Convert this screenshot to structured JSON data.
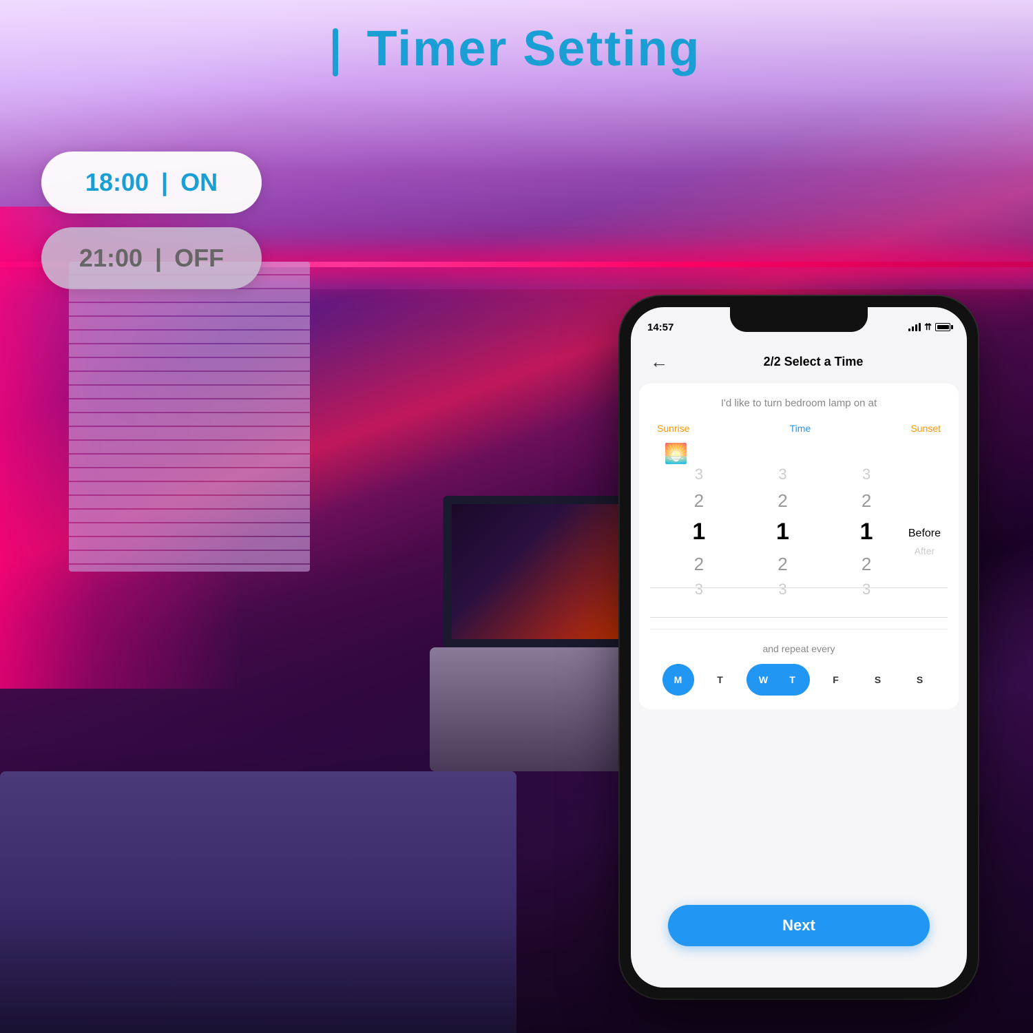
{
  "page": {
    "title": "Timer Setting",
    "background_color": "#1a0a2e"
  },
  "header": {
    "title_bar": "|",
    "title": "Timer Setting"
  },
  "timer_badges": [
    {
      "time": "18:00",
      "separator": "|",
      "action": "ON",
      "type": "on"
    },
    {
      "time": "21:00",
      "separator": "|",
      "action": "OFF",
      "type": "off"
    }
  ],
  "phone": {
    "status_bar": {
      "time": "14:57",
      "signal_label": "signal",
      "wifi_label": "wifi",
      "battery_label": "battery"
    },
    "screen_title": "2/2 Select a Time",
    "back_button": "←",
    "description": "I'd like to turn bedroom lamp on at",
    "time_picker": {
      "sunrise_label": "Sunrise",
      "time_label": "Time",
      "sunset_label": "Sunset",
      "columns": [
        {
          "id": "col1",
          "values": [
            "3",
            "2",
            "1",
            "2",
            "3"
          ]
        },
        {
          "id": "col2",
          "values": [
            "3",
            "2",
            "1",
            "2",
            "3"
          ]
        },
        {
          "id": "col3",
          "values": [
            "3",
            "2",
            "1",
            "2",
            "3"
          ]
        }
      ],
      "before_after": {
        "before": "Before",
        "after": "After"
      }
    },
    "repeat_label": "and repeat every",
    "days": [
      {
        "label": "M",
        "id": "monday",
        "state": "active"
      },
      {
        "label": "T",
        "id": "tuesday",
        "state": "inactive"
      },
      {
        "label": "W",
        "id": "wednesday",
        "state": "range-start"
      },
      {
        "label": "T",
        "id": "thursday",
        "state": "range-end"
      },
      {
        "label": "F",
        "id": "friday",
        "state": "inactive"
      },
      {
        "label": "S",
        "id": "saturday",
        "state": "inactive"
      },
      {
        "label": "S",
        "id": "sunday",
        "state": "inactive"
      }
    ],
    "next_button": "Next"
  }
}
